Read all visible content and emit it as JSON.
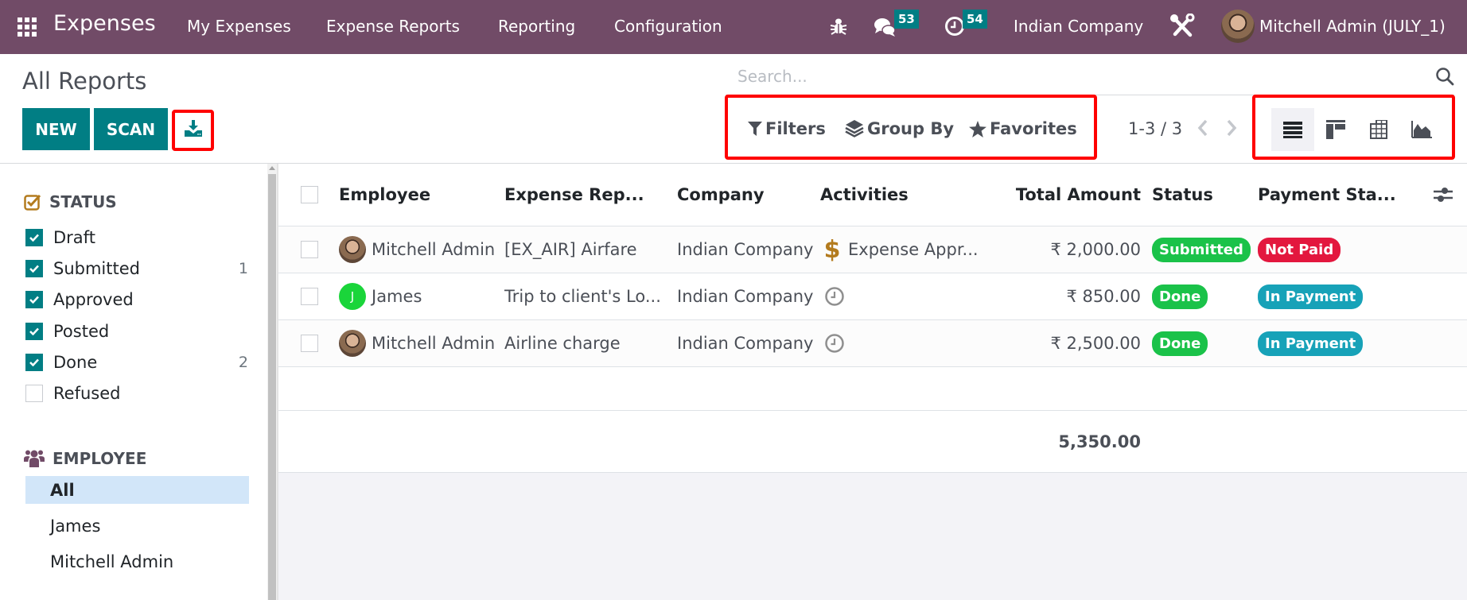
{
  "navbar": {
    "app_name": "Expenses",
    "menus": [
      "My Expenses",
      "Expense Reports",
      "Reporting",
      "Configuration"
    ],
    "messages_count": "53",
    "activities_count": "54",
    "company": "Indian Company",
    "user": "Mitchell Admin (JULY_1)",
    "brand_color": "#714b67"
  },
  "control_panel": {
    "title": "All Reports",
    "new_label": "NEW",
    "scan_label": "SCAN",
    "search_placeholder": "Search...",
    "filters_label": "Filters",
    "group_by_label": "Group By",
    "favorites_label": "Favorites",
    "pager": "1-3 / 3",
    "views": [
      "list",
      "kanban",
      "pivot",
      "graph"
    ],
    "active_view": "list",
    "accent_color": "#017e84"
  },
  "sidebar": {
    "status_header": "STATUS",
    "status_items": [
      {
        "label": "Draft",
        "checked": true,
        "count": ""
      },
      {
        "label": "Submitted",
        "checked": true,
        "count": "1"
      },
      {
        "label": "Approved",
        "checked": true,
        "count": ""
      },
      {
        "label": "Posted",
        "checked": true,
        "count": ""
      },
      {
        "label": "Done",
        "checked": true,
        "count": "2"
      },
      {
        "label": "Refused",
        "checked": false,
        "count": ""
      }
    ],
    "employee_header": "EMPLOYEE",
    "employee_items": [
      {
        "label": "All",
        "active": true
      },
      {
        "label": "James",
        "active": false
      },
      {
        "label": "Mitchell Admin",
        "active": false
      }
    ]
  },
  "table": {
    "columns": [
      "Employee",
      "Expense Rep...",
      "Company",
      "Activities",
      "Total Amount",
      "Status",
      "Payment Sta..."
    ],
    "rows": [
      {
        "employee": "Mitchell Admin",
        "avatar": "photo",
        "report": "[EX_AIR] Airfare",
        "company": "Indian Company",
        "activity_icon": "dollar-icon",
        "activity": "Expense Appr...",
        "total": "₹ 2,000.00",
        "status": "Submitted",
        "status_color": "#21b799",
        "payment": "Not Paid",
        "payment_color": "#e3173e"
      },
      {
        "employee": "James",
        "avatar": "J",
        "report": "Trip to client's Lo...",
        "company": "Indian Company",
        "activity_icon": "clock-icon",
        "activity": "",
        "total": "₹ 850.00",
        "status": "Done",
        "status_color": "#21b799",
        "payment": "In Payment",
        "payment_color": "#17a2b8"
      },
      {
        "employee": "Mitchell Admin",
        "avatar": "photo",
        "report": "Airline charge",
        "company": "Indian Company",
        "activity_icon": "clock-icon",
        "activity": "",
        "total": "₹ 2,500.00",
        "status": "Done",
        "status_color": "#21b799",
        "payment": "In Payment",
        "payment_color": "#17a2b8"
      }
    ],
    "footer_total": "5,350.00"
  }
}
